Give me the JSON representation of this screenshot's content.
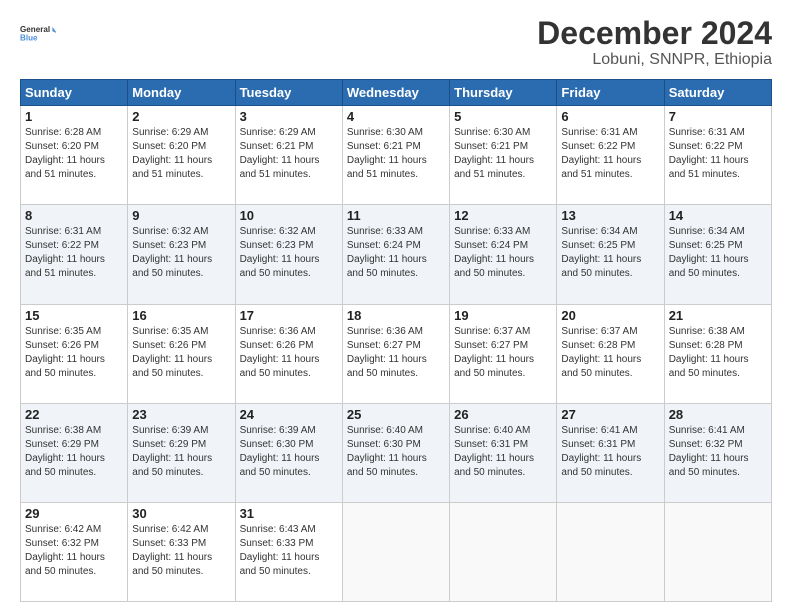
{
  "logo": {
    "line1": "General",
    "line2": "Blue"
  },
  "title": "December 2024",
  "subtitle": "Lobuni, SNNPR, Ethiopia",
  "weekdays": [
    "Sunday",
    "Monday",
    "Tuesday",
    "Wednesday",
    "Thursday",
    "Friday",
    "Saturday"
  ],
  "weeks": [
    [
      {
        "day": 1,
        "sunrise": "6:28 AM",
        "sunset": "6:20 PM",
        "daylight": "11 hours and 51 minutes."
      },
      {
        "day": 2,
        "sunrise": "6:29 AM",
        "sunset": "6:20 PM",
        "daylight": "11 hours and 51 minutes."
      },
      {
        "day": 3,
        "sunrise": "6:29 AM",
        "sunset": "6:21 PM",
        "daylight": "11 hours and 51 minutes."
      },
      {
        "day": 4,
        "sunrise": "6:30 AM",
        "sunset": "6:21 PM",
        "daylight": "11 hours and 51 minutes."
      },
      {
        "day": 5,
        "sunrise": "6:30 AM",
        "sunset": "6:21 PM",
        "daylight": "11 hours and 51 minutes."
      },
      {
        "day": 6,
        "sunrise": "6:31 AM",
        "sunset": "6:22 PM",
        "daylight": "11 hours and 51 minutes."
      },
      {
        "day": 7,
        "sunrise": "6:31 AM",
        "sunset": "6:22 PM",
        "daylight": "11 hours and 51 minutes."
      }
    ],
    [
      {
        "day": 8,
        "sunrise": "6:31 AM",
        "sunset": "6:22 PM",
        "daylight": "11 hours and 51 minutes."
      },
      {
        "day": 9,
        "sunrise": "6:32 AM",
        "sunset": "6:23 PM",
        "daylight": "11 hours and 50 minutes."
      },
      {
        "day": 10,
        "sunrise": "6:32 AM",
        "sunset": "6:23 PM",
        "daylight": "11 hours and 50 minutes."
      },
      {
        "day": 11,
        "sunrise": "6:33 AM",
        "sunset": "6:24 PM",
        "daylight": "11 hours and 50 minutes."
      },
      {
        "day": 12,
        "sunrise": "6:33 AM",
        "sunset": "6:24 PM",
        "daylight": "11 hours and 50 minutes."
      },
      {
        "day": 13,
        "sunrise": "6:34 AM",
        "sunset": "6:25 PM",
        "daylight": "11 hours and 50 minutes."
      },
      {
        "day": 14,
        "sunrise": "6:34 AM",
        "sunset": "6:25 PM",
        "daylight": "11 hours and 50 minutes."
      }
    ],
    [
      {
        "day": 15,
        "sunrise": "6:35 AM",
        "sunset": "6:26 PM",
        "daylight": "11 hours and 50 minutes."
      },
      {
        "day": 16,
        "sunrise": "6:35 AM",
        "sunset": "6:26 PM",
        "daylight": "11 hours and 50 minutes."
      },
      {
        "day": 17,
        "sunrise": "6:36 AM",
        "sunset": "6:26 PM",
        "daylight": "11 hours and 50 minutes."
      },
      {
        "day": 18,
        "sunrise": "6:36 AM",
        "sunset": "6:27 PM",
        "daylight": "11 hours and 50 minutes."
      },
      {
        "day": 19,
        "sunrise": "6:37 AM",
        "sunset": "6:27 PM",
        "daylight": "11 hours and 50 minutes."
      },
      {
        "day": 20,
        "sunrise": "6:37 AM",
        "sunset": "6:28 PM",
        "daylight": "11 hours and 50 minutes."
      },
      {
        "day": 21,
        "sunrise": "6:38 AM",
        "sunset": "6:28 PM",
        "daylight": "11 hours and 50 minutes."
      }
    ],
    [
      {
        "day": 22,
        "sunrise": "6:38 AM",
        "sunset": "6:29 PM",
        "daylight": "11 hours and 50 minutes."
      },
      {
        "day": 23,
        "sunrise": "6:39 AM",
        "sunset": "6:29 PM",
        "daylight": "11 hours and 50 minutes."
      },
      {
        "day": 24,
        "sunrise": "6:39 AM",
        "sunset": "6:30 PM",
        "daylight": "11 hours and 50 minutes."
      },
      {
        "day": 25,
        "sunrise": "6:40 AM",
        "sunset": "6:30 PM",
        "daylight": "11 hours and 50 minutes."
      },
      {
        "day": 26,
        "sunrise": "6:40 AM",
        "sunset": "6:31 PM",
        "daylight": "11 hours and 50 minutes."
      },
      {
        "day": 27,
        "sunrise": "6:41 AM",
        "sunset": "6:31 PM",
        "daylight": "11 hours and 50 minutes."
      },
      {
        "day": 28,
        "sunrise": "6:41 AM",
        "sunset": "6:32 PM",
        "daylight": "11 hours and 50 minutes."
      }
    ],
    [
      {
        "day": 29,
        "sunrise": "6:42 AM",
        "sunset": "6:32 PM",
        "daylight": "11 hours and 50 minutes."
      },
      {
        "day": 30,
        "sunrise": "6:42 AM",
        "sunset": "6:33 PM",
        "daylight": "11 hours and 50 minutes."
      },
      {
        "day": 31,
        "sunrise": "6:43 AM",
        "sunset": "6:33 PM",
        "daylight": "11 hours and 50 minutes."
      },
      null,
      null,
      null,
      null
    ]
  ]
}
